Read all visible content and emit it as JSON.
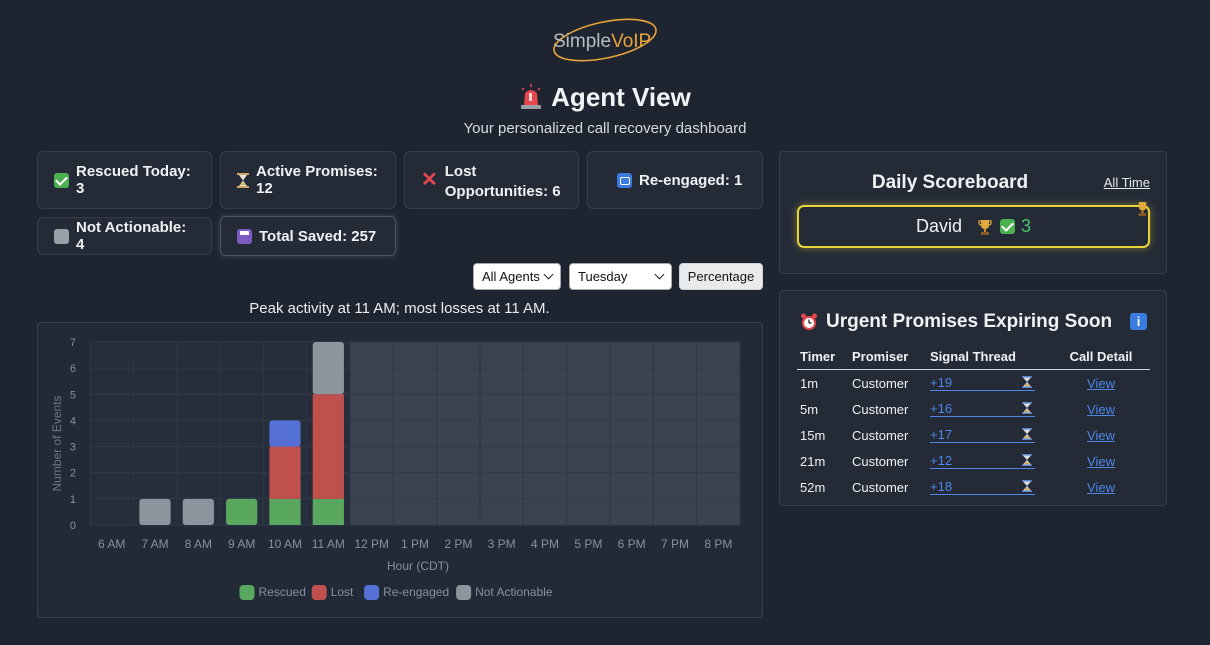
{
  "logo": {
    "text": "SimpleVoIP",
    "text_plain": "Simple",
    "text_accent": "VoIP",
    "accent_color": "#e8a33a"
  },
  "header": {
    "title": "Agent View",
    "subtitle": "Your personalized call recovery dashboard",
    "title_icon": "siren-icon"
  },
  "stats": {
    "rescued_today": "Rescued Today: 3",
    "active_promises": "Active Promises: 12",
    "lost_opportunities": "Lost Opportunities: 6",
    "reengaged": "Re-engaged: 1",
    "not_actionable": "Not Actionable: 4",
    "total_saved": "Total Saved: 257"
  },
  "filters": {
    "agent": "All Agents",
    "day": "Tuesday",
    "percentage_button": "Percentage"
  },
  "peak_text": "Peak activity at 11 AM; most losses at 11 AM.",
  "chart_data": {
    "type": "bar",
    "stacked": true,
    "categories": [
      "6 AM",
      "7 AM",
      "8 AM",
      "9 AM",
      "10 AM",
      "11 AM",
      "12 PM",
      "1 PM",
      "2 PM",
      "3 PM",
      "4 PM",
      "5 PM",
      "6 PM",
      "7 PM",
      "8 PM"
    ],
    "series": [
      {
        "name": "Rescued",
        "color": "#5aa860",
        "values": [
          0,
          0,
          0,
          1,
          1,
          1,
          0,
          0,
          0,
          0,
          0,
          0,
          0,
          0,
          0
        ]
      },
      {
        "name": "Lost",
        "color": "#c0504d",
        "values": [
          0,
          0,
          0,
          0,
          2,
          4,
          0,
          0,
          0,
          0,
          0,
          0,
          0,
          0,
          0
        ]
      },
      {
        "name": "Re-engaged",
        "color": "#5470d6",
        "values": [
          0,
          0,
          0,
          0,
          1,
          0,
          0,
          0,
          0,
          0,
          0,
          0,
          0,
          0,
          0
        ]
      },
      {
        "name": "Not Actionable",
        "color": "#8e949e",
        "values": [
          0,
          1,
          1,
          0,
          0,
          2,
          0,
          0,
          0,
          0,
          0,
          0,
          0,
          0,
          0
        ]
      }
    ],
    "xlabel": "Hour (CDT)",
    "ylabel": "Number of Events",
    "ylim": [
      0,
      7
    ],
    "yticks": [
      0,
      1,
      2,
      3,
      4,
      5,
      6,
      7
    ],
    "grid": true,
    "legend": "bottom",
    "highlight_from": "12 PM"
  },
  "scoreboard": {
    "title": "Daily Scoreboard",
    "all_time_link": "All Time",
    "leader_name": "David",
    "leader_score": "3"
  },
  "urgent": {
    "title": "Urgent Promises Expiring Soon",
    "headers": [
      "Timer",
      "Promiser",
      "Signal Thread",
      "Call Detail"
    ],
    "rows": [
      {
        "timer": "1m",
        "promiser": "Customer",
        "signal": "+19",
        "detail": "View"
      },
      {
        "timer": "5m",
        "promiser": "Customer",
        "signal": "+16",
        "detail": "View"
      },
      {
        "timer": "15m",
        "promiser": "Customer",
        "signal": "+17",
        "detail": "View"
      },
      {
        "timer": "21m",
        "promiser": "Customer",
        "signal": "+12",
        "detail": "View"
      },
      {
        "timer": "52m",
        "promiser": "Customer",
        "signal": "+18",
        "detail": "View"
      }
    ]
  }
}
